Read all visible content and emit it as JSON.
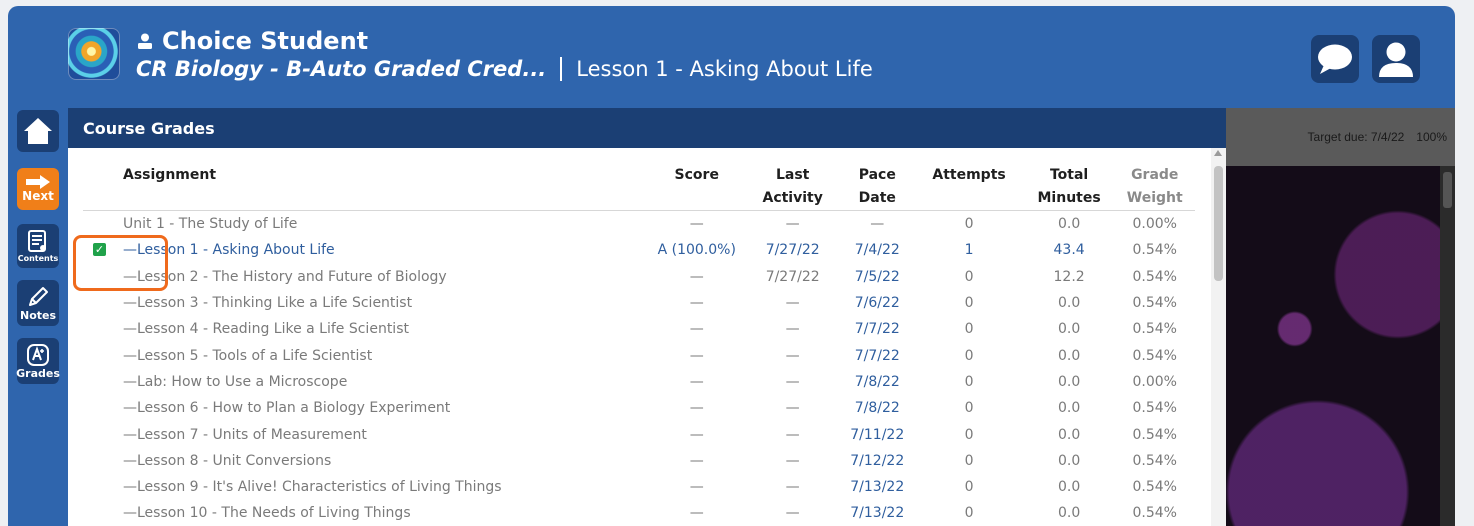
{
  "header": {
    "student_name": "Choice Student",
    "course_name": "CR Biology - B-Auto Graded Cred...",
    "lesson_title": "Lesson 1 - Asking About Life"
  },
  "sidebar": {
    "next_label": "Next",
    "contents_label": "Contents",
    "notes_label": "Notes",
    "grades_label": "Grades"
  },
  "panel": {
    "title": "Course Grades"
  },
  "table": {
    "columns": {
      "assignment": "Assignment",
      "score": "Score",
      "last_activity_1": "Last",
      "last_activity_2": "Activity",
      "pace_1": "Pace",
      "pace_2": "Date",
      "attempts": "Attempts",
      "total_1": "Total",
      "total_2": "Minutes",
      "weight_1": "Grade",
      "weight_2": "Weight"
    },
    "rows": [
      {
        "assignment": "Unit 1 - The Study of Life",
        "score": "—",
        "last": "—",
        "pace": "—",
        "attempts": "0",
        "minutes": "0.0",
        "weight": "0.00%"
      },
      {
        "assignment": "—Lesson 1 - Asking About Life",
        "score": "A (100.0%)",
        "last": "7/27/22",
        "pace": "7/4/22",
        "attempts": "1",
        "minutes": "43.4",
        "weight": "0.54%"
      },
      {
        "assignment": "—Lesson 2 - The History and Future of Biology",
        "score": "—",
        "last": "7/27/22",
        "pace": "7/5/22",
        "attempts": "0",
        "minutes": "12.2",
        "weight": "0.54%"
      },
      {
        "assignment": "—Lesson 3 - Thinking Like a Life Scientist",
        "score": "—",
        "last": "—",
        "pace": "7/6/22",
        "attempts": "0",
        "minutes": "0.0",
        "weight": "0.54%"
      },
      {
        "assignment": "—Lesson 4 - Reading Like a Life Scientist",
        "score": "—",
        "last": "—",
        "pace": "7/7/22",
        "attempts": "0",
        "minutes": "0.0",
        "weight": "0.54%"
      },
      {
        "assignment": "—Lesson 5 - Tools of a Life Scientist",
        "score": "—",
        "last": "—",
        "pace": "7/7/22",
        "attempts": "0",
        "minutes": "0.0",
        "weight": "0.54%"
      },
      {
        "assignment": "—Lab: How to Use a Microscope",
        "score": "—",
        "last": "—",
        "pace": "7/8/22",
        "attempts": "0",
        "minutes": "0.0",
        "weight": "0.00%"
      },
      {
        "assignment": "—Lesson 6 - How to Plan a Biology Experiment",
        "score": "—",
        "last": "—",
        "pace": "7/8/22",
        "attempts": "0",
        "minutes": "0.0",
        "weight": "0.54%"
      },
      {
        "assignment": "—Lesson 7 - Units of Measurement",
        "score": "—",
        "last": "—",
        "pace": "7/11/22",
        "attempts": "0",
        "minutes": "0.0",
        "weight": "0.54%"
      },
      {
        "assignment": "—Lesson 8 - Unit Conversions",
        "score": "—",
        "last": "—",
        "pace": "7/12/22",
        "attempts": "0",
        "minutes": "0.0",
        "weight": "0.54%"
      },
      {
        "assignment": "—Lesson 9 - It's Alive! Characteristics of Living Things",
        "score": "—",
        "last": "—",
        "pace": "7/13/22",
        "attempts": "0",
        "minutes": "0.0",
        "weight": "0.54%"
      },
      {
        "assignment": "—Lesson 10 - The Needs of Living Things",
        "score": "—",
        "last": "—",
        "pace": "7/13/22",
        "attempts": "0",
        "minutes": "0.0",
        "weight": "0.54%"
      }
    ]
  },
  "right_panel": {
    "target_due": "Target due: 7/4/22",
    "progress": "100%"
  },
  "colors": {
    "header_bg": "#2f65ad",
    "dark_navy": "#1b3f74",
    "next_orange": "#f07f19",
    "highlight": "#ef6a1c",
    "link_blue": "#2f5e9e"
  }
}
